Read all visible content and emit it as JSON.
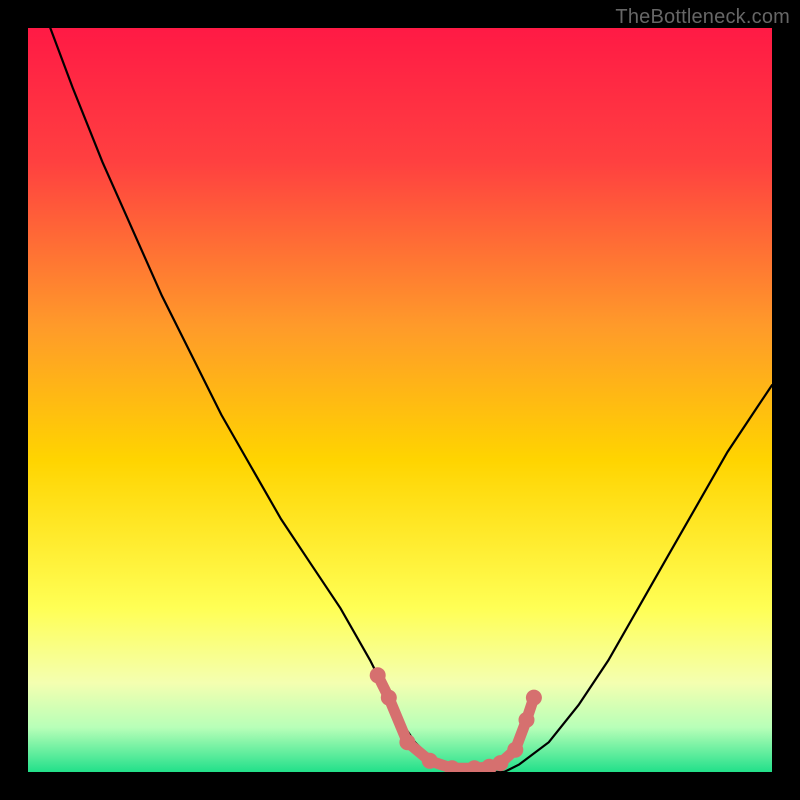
{
  "watermark": "TheBottleneck.com",
  "colors": {
    "frame": "#000000",
    "grad_top": "#ff1a45",
    "grad_mid1": "#ff7a2a",
    "grad_mid2": "#ffd400",
    "grad_low1": "#ffff66",
    "grad_low2": "#e6ffb3",
    "grad_bottom": "#22e08a",
    "curve": "#000000",
    "markers": "#d6706f"
  },
  "chart_data": {
    "type": "line",
    "title": "",
    "xlabel": "",
    "ylabel": "",
    "xlim": [
      0,
      100
    ],
    "ylim": [
      0,
      100
    ],
    "series": [
      {
        "name": "bottleneck-curve",
        "x": [
          3,
          6,
          10,
          14,
          18,
          22,
          26,
          30,
          34,
          38,
          42,
          46,
          48,
          50,
          52,
          54,
          56,
          58,
          60,
          62,
          64,
          66,
          70,
          74,
          78,
          82,
          86,
          90,
          94,
          98,
          100
        ],
        "y": [
          100,
          92,
          82,
          73,
          64,
          56,
          48,
          41,
          34,
          28,
          22,
          15,
          11,
          7,
          4,
          2,
          1,
          0,
          0,
          0,
          0,
          1,
          4,
          9,
          15,
          22,
          29,
          36,
          43,
          49,
          52
        ]
      }
    ],
    "markers": {
      "name": "highlight-points",
      "x": [
        47,
        48.5,
        51,
        54,
        57,
        60,
        62,
        63.5,
        65.5,
        67,
        68
      ],
      "y": [
        13,
        10,
        4,
        1.5,
        0.5,
        0.5,
        0.7,
        1.2,
        3,
        7,
        10
      ]
    }
  }
}
